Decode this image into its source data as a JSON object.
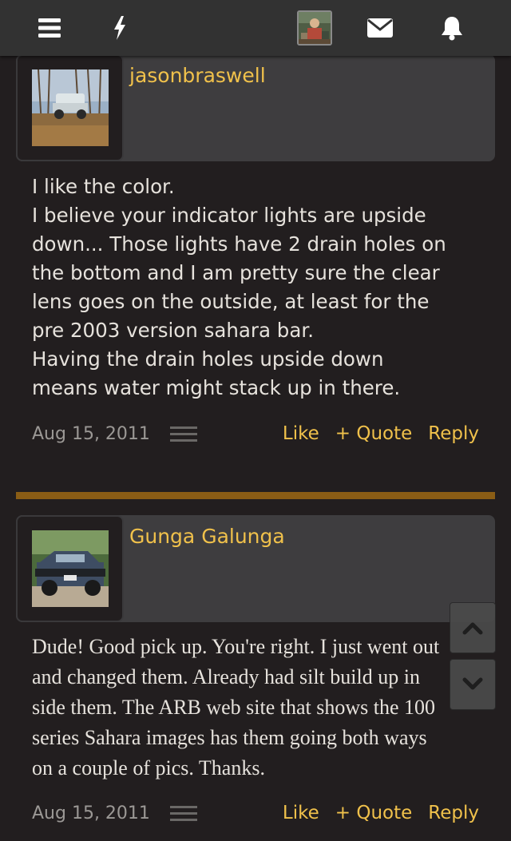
{
  "nav": {
    "icons": [
      "menu-icon",
      "bolt-icon",
      "user-avatar",
      "envelope-icon",
      "bell-icon"
    ]
  },
  "posts": [
    {
      "username": "jasonbraswell",
      "lines": [
        "I like the color.",
        "I believe your indicator lights are upside",
        "down... Those lights have 2 drain holes on",
        "the bottom and I am pretty sure the clear",
        "lens goes on the outside, at least for the",
        "pre 2003 version sahara bar.",
        "Having the drain holes upside down",
        "means water might stack up in there."
      ],
      "date": "Aug 15, 2011",
      "like": "Like",
      "quote": "+ Quote",
      "reply": "Reply"
    },
    {
      "username": "Gunga Galunga",
      "lines": [
        "Dude! Good pick up. You're right. I just went out",
        "and changed them. Already had silt build up in",
        "side them. The ARB web site that shows the 100",
        "series Sahara images has them going both ways",
        "on a couple of pics. Thanks."
      ],
      "date": "Aug 15, 2011",
      "like": "Like",
      "quote": "+ Quote",
      "reply": "Reply"
    }
  ],
  "colors": {
    "background": "#221e1f",
    "navbar": "#323232",
    "accent": "#f0c14b",
    "separator": "#8a5d15",
    "header": "#3e3d3f"
  }
}
